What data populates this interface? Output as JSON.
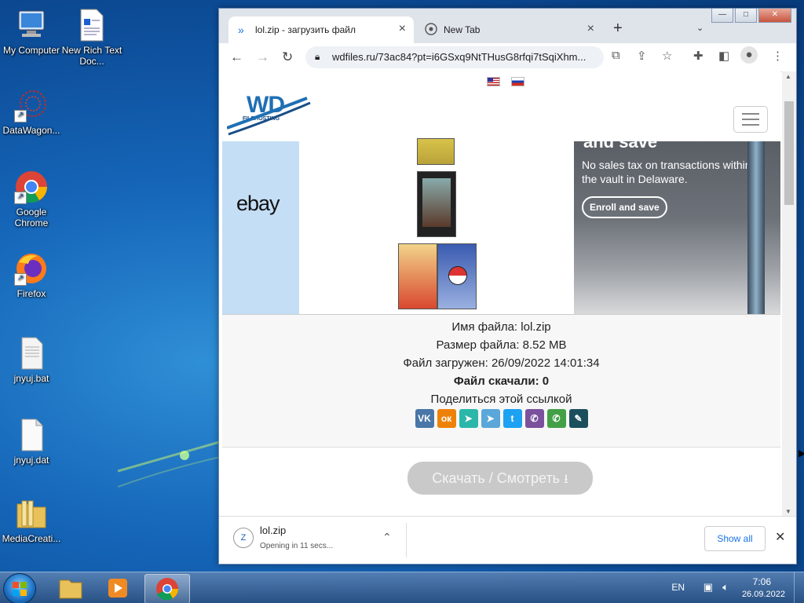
{
  "desktop": {
    "icons": [
      {
        "label": "My Computer",
        "icon": "computer-icon"
      },
      {
        "label": "New Rich Text Doc...",
        "icon": "document-icon"
      },
      {
        "label": "DataWagon...",
        "icon": "network-icon"
      },
      {
        "label": "Google Chrome",
        "icon": "chrome-icon"
      },
      {
        "label": "Firefox",
        "icon": "firefox-icon"
      },
      {
        "label": "jnyuj.bat",
        "icon": "batch-file-icon"
      },
      {
        "label": "jnyuj.dat",
        "icon": "file-icon"
      },
      {
        "label": "MediaCreati...",
        "icon": "folder-icon"
      }
    ]
  },
  "browser": {
    "tabs": [
      {
        "title": "lol.zip - загрузить файл",
        "active": true
      },
      {
        "title": "New Tab",
        "active": false
      }
    ],
    "url": "wdfiles.ru/73ac84?pt=i6GSxq9NtTHusG8rfqi7tSqiXhm...",
    "window_controls": {
      "minimize": "—",
      "maximize": "□",
      "close": "✕"
    }
  },
  "page": {
    "logo_text": "WD",
    "logo_sub": "FILEHOSTING",
    "ad": {
      "brand": "ebay",
      "headline": "and save",
      "body": "No sales tax on transactions within the vault in Delaware.",
      "cta": "Enroll and save"
    },
    "file": {
      "name_label": "Имя файла:",
      "name_value": "lol.zip",
      "size_label": "Размер файла:",
      "size_value": "8.52 MB",
      "uploaded_label": "Файл загружен:",
      "uploaded_value": "26/09/2022 14:01:34",
      "downloads_label": "Файл скачали:",
      "downloads_value": "0",
      "share_label": "Поделиться этой ссылкой"
    },
    "share_buttons": [
      {
        "name": "vk",
        "glyph": "VK",
        "color": "#4a76a8"
      },
      {
        "name": "ok",
        "glyph": "ок",
        "color": "#ee8208"
      },
      {
        "name": "send",
        "glyph": "➤",
        "color": "#2ab7a9"
      },
      {
        "name": "telegram",
        "glyph": "➤",
        "color": "#5aa7d9"
      },
      {
        "name": "twitter",
        "glyph": "t",
        "color": "#1da1f2"
      },
      {
        "name": "viber",
        "glyph": "✆",
        "color": "#7b519d"
      },
      {
        "name": "whatsapp",
        "glyph": "✆",
        "color": "#43a047"
      },
      {
        "name": "livejournal",
        "glyph": "✎",
        "color": "#1b4f5e"
      }
    ],
    "download_button": "Скачать / Смотреть"
  },
  "download_bar": {
    "filename": "lol.zip",
    "status": "Opening in 11 secs...",
    "show_all": "Show all"
  },
  "taskbar": {
    "lang": "EN",
    "time": "7:06",
    "date": "26.09.2022"
  }
}
